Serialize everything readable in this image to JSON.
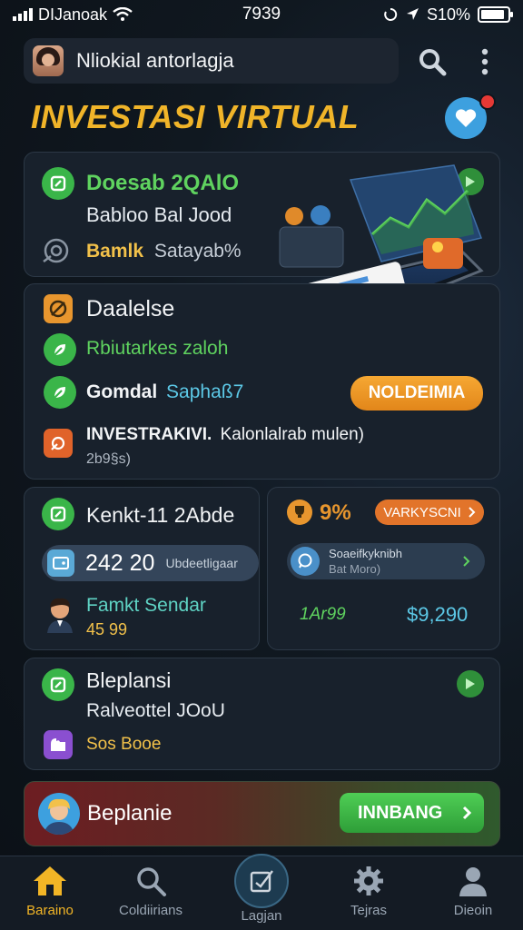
{
  "status_bar": {
    "carrier": "DIJanoak",
    "time": "7939",
    "battery_text": "S10%"
  },
  "header": {
    "user_name": "Nliokial antorlagja"
  },
  "page_title": "INVESTASI VIRTUAL",
  "card1": {
    "title": "Doesab 2QAlO",
    "subtitle": "Babloo Bal Jood",
    "row_label": "Bamlk",
    "row_value": "Satayab%"
  },
  "card2": {
    "title": "Daalelse",
    "item1": "Rbiutarkes zaloh",
    "item2_label": "Gomdal",
    "item2_value": "Saphaß7",
    "button": "NOLDEIMIA",
    "footer_bold": "INVESTRAKIVI.",
    "footer_rest": "Kalonlalrab mulen)",
    "footer_value": "2b9§s)"
  },
  "card3": {
    "title": "Kenkt-11 2Abde",
    "pill_value": "242 20",
    "pill_label": "Ubdeetligaar",
    "person_name": "Famkt Sendar",
    "person_value": "45 99"
  },
  "card4": {
    "percent": "9%",
    "button": "VARKYSCNI",
    "pill_title": "Soaeifkyknibh",
    "pill_sub": "Bat Moro)",
    "left_value": "1Ar99",
    "right_value": "$9,290"
  },
  "card5": {
    "title": "Bleplansi",
    "subtitle": "Ralveottel JOoU",
    "row_label": "Sos Booe"
  },
  "banner": {
    "label": "Beplanie",
    "button": "INNBANG"
  },
  "nav": {
    "items": [
      "Baraino",
      "Coldiirians",
      "Lagjan",
      "Tejras",
      "Dieoin"
    ]
  },
  "colors": {
    "accent_gold": "#f0b429",
    "accent_green": "#3ab549",
    "accent_orange": "#e2861a",
    "accent_blue": "#3da0df"
  }
}
